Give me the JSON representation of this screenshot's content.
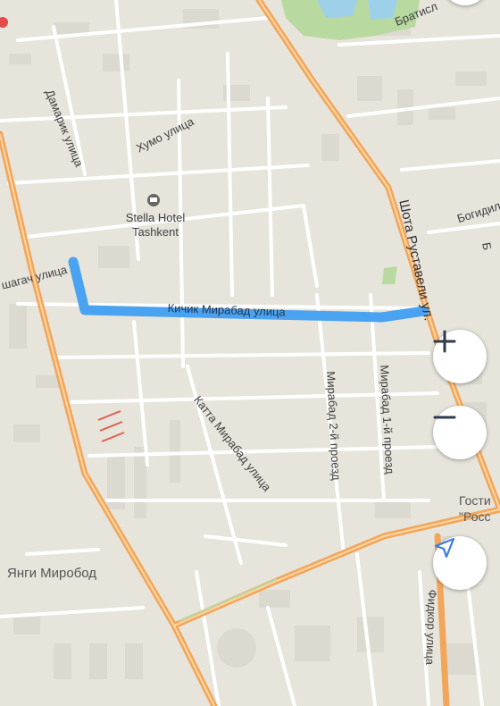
{
  "map": {
    "colors": {
      "land": "#e7e4dc",
      "block": "#dedbd2",
      "street": "#ffffff",
      "arterial": "#f4a35a",
      "park": "#b8d9a0",
      "water": "#9fd0ea",
      "route": "#4aa3f0"
    },
    "labels": {
      "bratislava_street": "Братисл",
      "bogidil_street": "Богидил",
      "damarik_street": "Дамарик улица",
      "khumo_street": "Хумо улица",
      "hotel_name": "Stella Hotel Tashkent",
      "shagach_street": "шагач улица",
      "rustaveli_street": "Шота Руставели ул.",
      "kichik_mirabad_street": "Кичик Мирабад улица",
      "katta_mirabad_street": "Катта Мирабад улица",
      "mirabad_2_proezd": "Мирабад 2-й проезд",
      "mirabad_1_proezd": "Мирабад 1-й проезд",
      "yangi_mirobod": "Янги Миробод",
      "fidkor_street": "Фидкор улица",
      "hotel_rossiya_top": "Гости",
      "hotel_rossiya_bottom": "\"Росс",
      "right_edge_label": "Б"
    },
    "icons": {
      "hotel": "hotel-bed-icon",
      "zoom_in": "plus-icon",
      "zoom_out": "minus-icon",
      "my_location": "navigation-arrow-icon"
    }
  }
}
